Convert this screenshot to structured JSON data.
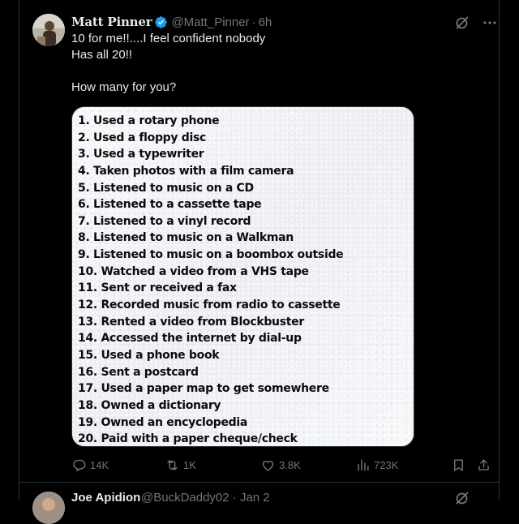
{
  "tweet": {
    "author": {
      "display_name": "Matt Pinner",
      "handle": "@Matt_Pinner",
      "separator": "·",
      "time": "6h"
    },
    "text_lines": [
      "10 for me!!....I feel confident nobody",
      "Has all 20!!",
      "",
      "How many for you?"
    ],
    "media_list": [
      "1. Used a rotary phone",
      "2. Used a floppy disc",
      "3. Used a typewriter",
      "4. Taken photos with a film camera",
      "5. Listened to music on a CD",
      "6. Listened to a cassette tape",
      "7. Listened to a vinyl record",
      "8. Listened to music on a Walkman",
      "9. Listened to music on a boombox outside",
      "10. Watched a video from a VHS tape",
      "11. Sent or received a fax",
      "12. Recorded music from radio to cassette",
      "13. Rented a video from Blockbuster",
      "14. Accessed the internet by dial-up",
      "15. Used a phone book",
      "16. Sent a postcard",
      "17. Used a paper map to get somewhere",
      "18. Owned a dictionary",
      "19. Owned an encyclopedia",
      "20. Paid with a paper cheque/check"
    ],
    "stats": {
      "replies": "14K",
      "retweets": "1K",
      "likes": "3.8K",
      "views": "723K"
    }
  },
  "next_tweet": {
    "display_name": "Joe Apidion",
    "meta": "@BuckDaddy02 · Jan 2"
  },
  "colors": {
    "background": "#000000",
    "primary_text": "#e7e9ea",
    "secondary_text": "#71767b",
    "verified": "#1d9bf0",
    "border": "#2f3336"
  }
}
